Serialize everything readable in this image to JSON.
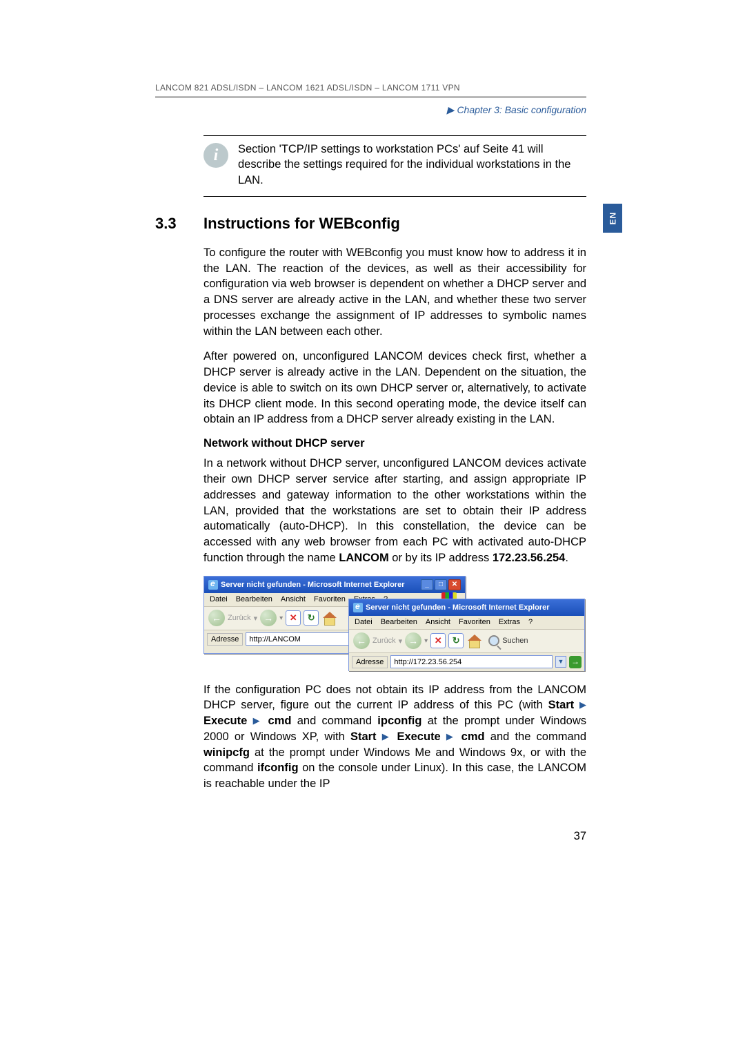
{
  "header": "LANCOM 821 ADSL/ISDN – LANCOM 1621 ADSL/ISDN – LANCOM 1711 VPN",
  "chapter": "Chapter 3: Basic configuration",
  "side_tab": "EN",
  "info_note": "Section 'TCP/IP settings to workstation PCs' auf Seite 41 will describe the settings required for the individual workstations in the LAN.",
  "section": {
    "number": "3.3",
    "title": "Instructions for WEBconfig"
  },
  "para1": "To configure the router with WEBconfig you must know how to address it in the LAN. The reaction of the devices, as well as their accessibility for configuration via web browser is dependent on whether a DHCP server and a DNS server are already active in the LAN, and whether these two server processes exchange the assignment of IP addresses to symbolic names within the LAN between each other.",
  "para2": "After powered on, unconfigured LANCOM devices check first, whether a DHCP server is already active in the LAN. Dependent on the situation, the device is able to switch on its own DHCP server or, alternatively, to activate its DHCP client mode. In this second operating mode, the device itself can obtain an IP address from a DHCP server already existing in the LAN.",
  "subhead1": "Network without DHCP server",
  "para3_pre": "In a network without DHCP server, unconfigured LANCOM devices activate their own DHCP server service after starting, and assign appropriate IP addresses and gateway information to the other workstations within the LAN, provided that the workstations are set to obtain their IP address automatically (auto-DHCP). In this constellation, the device can be accessed with any web browser from each PC with activated auto-DHCP function through the name ",
  "para3_b1": "LANCOM",
  "para3_mid": " or by its IP address ",
  "para3_b2": "172.23.56.254",
  "para3_end": ".",
  "screenshot": {
    "title": "Server nicht gefunden - Microsoft Internet Explorer",
    "menu": {
      "datei": "Datei",
      "bearbeiten": "Bearbeiten",
      "ansicht": "Ansicht",
      "favoriten": "Favoriten",
      "extras": "Extras",
      "help": "?"
    },
    "toolbar": {
      "back": "Zurück",
      "stop": "✕",
      "refresh": "↻",
      "search": "Suchen"
    },
    "addr_label": "Adresse",
    "addr1": "http://LANCOM",
    "addr2": "http://172.23.56.254",
    "winbtns": {
      "min": "_",
      "max": "□",
      "close": "✕"
    }
  },
  "para4": {
    "t1": "If the configuration PC does not obtain its IP address from the LANCOM DHCP server, figure out the current IP address of this PC (with ",
    "b1": "Start",
    "arrow": "▶",
    "b2": "Execute",
    "b3": "cmd",
    "t2": " and command ",
    "b4": "ipconfig",
    "t3": " at the prompt under Windows 2000 or Windows XP, with ",
    "b5": "Start",
    "b6": "Execute",
    "b7": "cmd",
    "t4": " and the command ",
    "b8": "winipcfg",
    "t5": " at the prompt under Windows Me and Windows 9x, or with the command ",
    "b9": "ifconfig",
    "t6": " on the console under Linux). In this case, the LANCOM is reachable under the IP"
  },
  "page_number": "37"
}
